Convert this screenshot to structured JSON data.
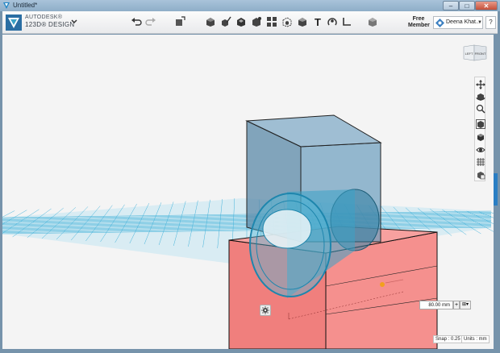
{
  "window": {
    "title": "Untitled*",
    "minimize_label": "–",
    "maximize_label": "□",
    "close_label": "✕"
  },
  "app": {
    "brand_line1": "AUTODESK®",
    "brand_line2": "123D® DESIGN",
    "menu_icon": "chevron-down-icon"
  },
  "toolbar": {
    "tools": [
      "undo-icon",
      "redo-icon",
      "transform-icon",
      "primitives-icon",
      "sketch-icon",
      "construct-icon",
      "modify-icon",
      "pattern-icon",
      "grouping-icon",
      "combine-icon",
      "measure-icon",
      "text-icon",
      "snap-icon",
      "material-icon",
      "parts-icon"
    ],
    "free_member_label": "Free\nMember",
    "user_name": "Deena Khat...",
    "help_label": "?"
  },
  "viewcube": {
    "left_face": "LEFT",
    "front_face": "FRONT"
  },
  "navbar": {
    "items": [
      "pan-icon",
      "orbit-icon",
      "zoom-icon",
      "fit-icon",
      "view-icon",
      "visibility-icon",
      "grid-toggle-icon",
      "material-view-icon"
    ]
  },
  "dimension": {
    "value": "80.00 mm",
    "plus_label": "+"
  },
  "status": {
    "snap": "Snap : 0.25",
    "units": "Units : mm"
  },
  "colors": {
    "accent": "#2a7ec4",
    "grid": "#2aa9d6",
    "blue_box": "#5b8aa8",
    "red_box": "#f07f7d",
    "cylinder": "#3aa2c6"
  }
}
